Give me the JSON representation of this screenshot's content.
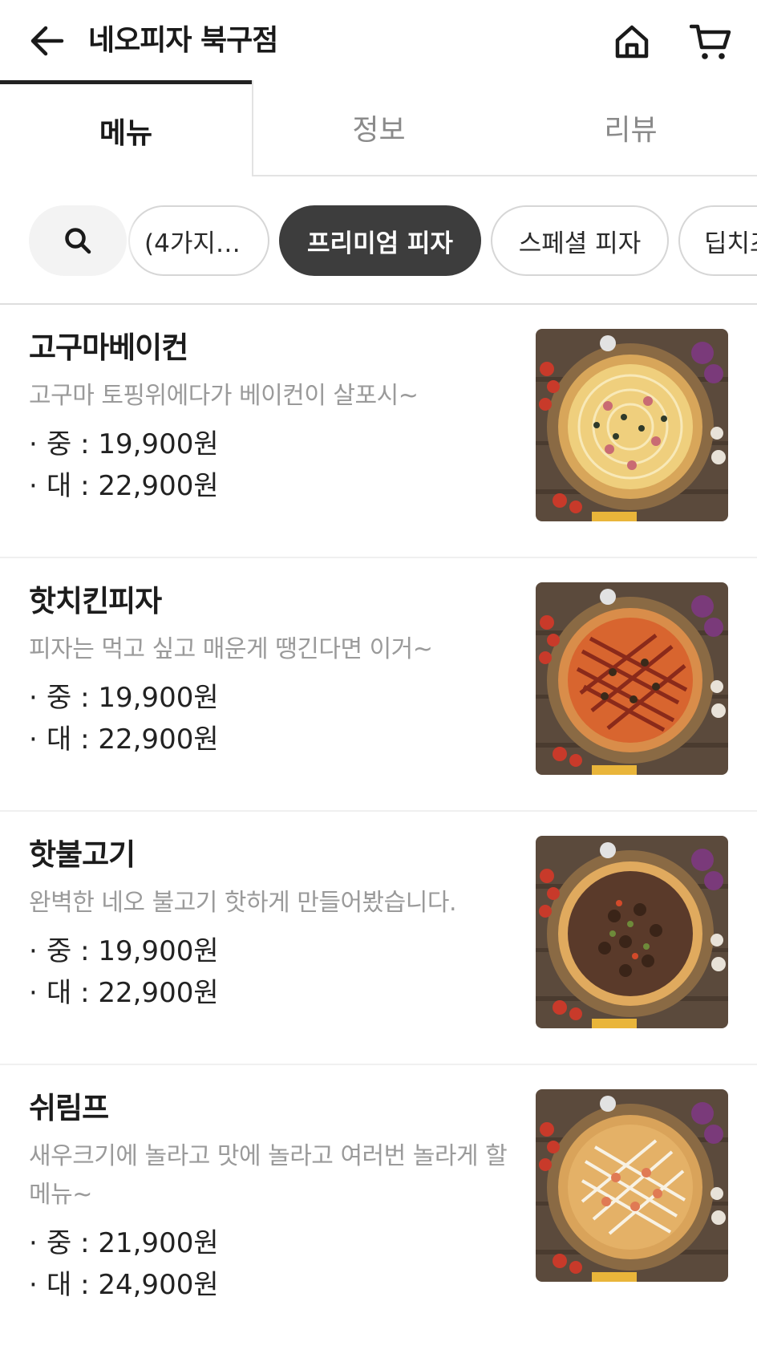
{
  "header": {
    "title": "네오피자 북구점",
    "back_icon": "arrow-left-icon",
    "home_icon": "home-icon",
    "cart_icon": "cart-icon"
  },
  "tabs": [
    {
      "label": "메뉴",
      "active": true
    },
    {
      "label": "정보",
      "active": false
    },
    {
      "label": "리뷰",
      "active": false
    }
  ],
  "categories": {
    "search_icon": "search-icon",
    "chips": [
      {
        "label": "(4가지…",
        "active": false
      },
      {
        "label": "프리미엄 피자",
        "active": true
      },
      {
        "label": "스페셜 피자",
        "active": false
      },
      {
        "label": "딥치즈",
        "active": false
      }
    ]
  },
  "menu": [
    {
      "name": "고구마베이컨",
      "description": "고구마 토핑위에다가 베이컨이 살포시~",
      "prices": [
        {
          "bullet": "·",
          "size": "중",
          "price": "19,900원"
        },
        {
          "bullet": "·",
          "size": "대",
          "price": "22,900원"
        }
      ],
      "image": "pizza-sweet-potato-bacon"
    },
    {
      "name": "핫치킨피자",
      "description": "피자는 먹고 싶고 매운게 땡긴다면 이거~",
      "prices": [
        {
          "bullet": "·",
          "size": "중",
          "price": "19,900원"
        },
        {
          "bullet": "·",
          "size": "대",
          "price": "22,900원"
        }
      ],
      "image": "pizza-hot-chicken"
    },
    {
      "name": "핫불고기",
      "description": "완벽한 네오 불고기 핫하게 만들어봤습니다.",
      "prices": [
        {
          "bullet": "·",
          "size": "중",
          "price": "19,900원"
        },
        {
          "bullet": "·",
          "size": "대",
          "price": "22,900원"
        }
      ],
      "image": "pizza-hot-bulgogi"
    },
    {
      "name": "쉬림프",
      "description": "새우크기에 놀라고 맛에 놀라고 여러번 놀라게 할 메뉴~",
      "prices": [
        {
          "bullet": "·",
          "size": "중",
          "price": "21,900원"
        },
        {
          "bullet": "·",
          "size": "대",
          "price": "24,900원"
        }
      ],
      "image": "pizza-shrimp"
    }
  ]
}
